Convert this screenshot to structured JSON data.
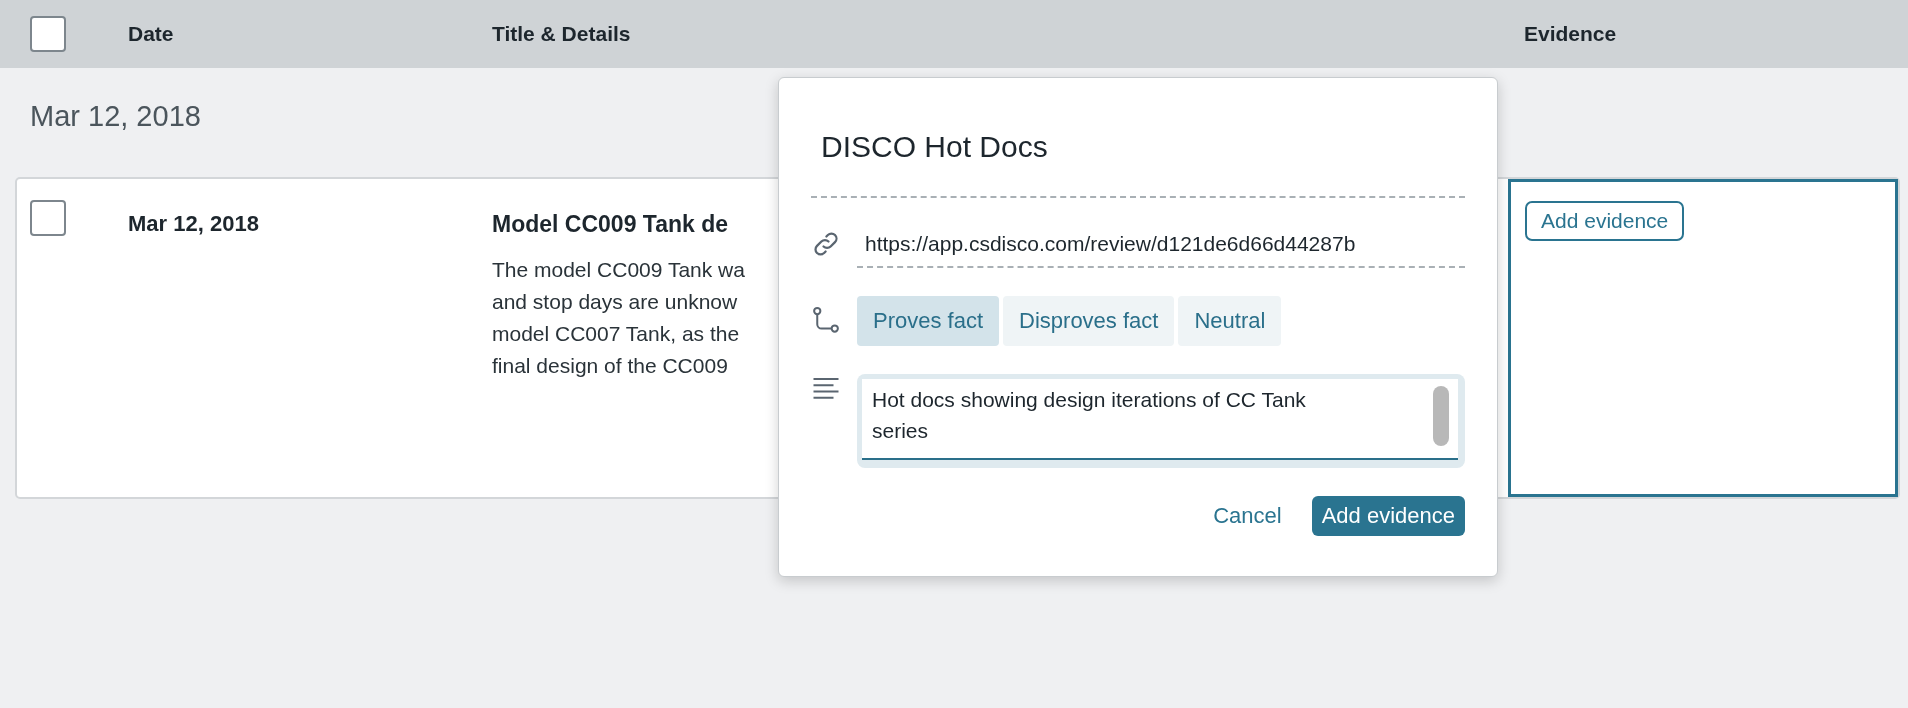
{
  "table": {
    "select_all": {
      "checked": false
    },
    "columns": [
      "Date",
      "Title & Details",
      "Evidence"
    ],
    "groups": [
      {
        "date": "Mar 12, 2018",
        "rows": [
          {
            "checked": false,
            "date": "Mar 12, 2018",
            "title": "Model CC009 Tank de",
            "details": [
              "The model CC009 Tank wa",
              "and stop days are unknow",
              "model CC007 Tank, as the",
              "final design of the CC009"
            ],
            "evidence_button": "Add evidence",
            "focused": true
          }
        ]
      }
    ]
  },
  "dialog": {
    "title": "DISCO Hot Docs",
    "link": {
      "value": "https://app.csdisco.com/review/d121de6d66d44287b"
    },
    "stance_options": [
      {
        "label": "Proves fact",
        "selected": true
      },
      {
        "label": "Disproves fact",
        "selected": false
      },
      {
        "label": "Neutral",
        "selected": false
      }
    ],
    "note": {
      "value": "Hot docs showing design iterations of CC Tank series"
    },
    "buttons": {
      "cancel": "Cancel",
      "submit": "Add evidence"
    }
  }
}
